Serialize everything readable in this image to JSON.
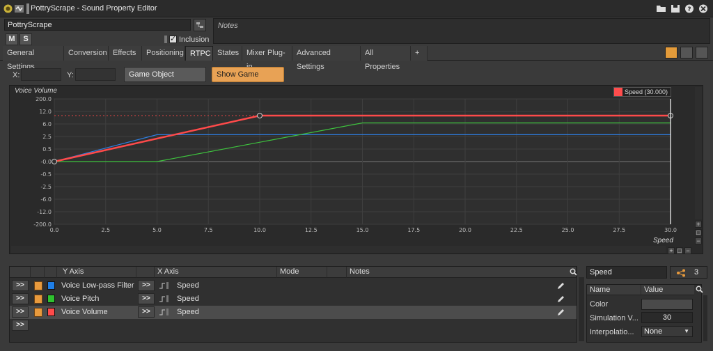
{
  "window": {
    "title": "PottryScrape - Sound Property Editor"
  },
  "object": {
    "name": "PottryScrape",
    "mute_label": "M",
    "solo_label": "S",
    "inclusion_label": "Inclusion",
    "notes_placeholder": "Notes"
  },
  "tabs": [
    "General Settings",
    "Conversion",
    "Effects",
    "Positioning",
    "RTPC",
    "States",
    "Mixer Plug-in",
    "Advanced Settings",
    "All Properties",
    "+"
  ],
  "active_tab": "RTPC",
  "toolbar": {
    "x_label": "X:",
    "y_label": "Y:",
    "explorer_label": "Game Object Explorer...",
    "show_objects_label": "Show Game Objects"
  },
  "graph": {
    "title": "Voice Volume",
    "x_axis_name": "Speed",
    "legend_text": "Speed (30.000)",
    "legend_color": "#ff4d4d"
  },
  "chart_data": {
    "type": "line",
    "xlabel": "Speed",
    "ylabel": "Voice Volume",
    "x_ticks": [
      "0.0",
      "2.5",
      "5.0",
      "7.5",
      "10.0",
      "12.5",
      "15.0",
      "17.5",
      "20.0",
      "22.5",
      "25.0",
      "27.5",
      "30.0"
    ],
    "y_ticks": [
      "200.0",
      "12.0",
      "6.0",
      "2.5",
      "0.5",
      "-0.0",
      "-0.5",
      "-2.5",
      "-6.0",
      "-12.0",
      "-200.0"
    ],
    "xlim": [
      0,
      30
    ],
    "cursor_x": 30.0,
    "series": [
      {
        "name": "Voice Volume",
        "color": "#ff4a4a",
        "points": [
          [
            0,
            0
          ],
          [
            10,
            10
          ],
          [
            30,
            10
          ]
        ]
      },
      {
        "name": "Voice Pitch",
        "color": "#3ec43e",
        "points": [
          [
            0,
            0
          ],
          [
            5,
            0
          ],
          [
            15,
            6.5
          ],
          [
            30,
            6.5
          ]
        ]
      },
      {
        "name": "Voice Low-pass Filter",
        "color": "#2e7de0",
        "points": [
          [
            0,
            0
          ],
          [
            5,
            3
          ],
          [
            30,
            3
          ]
        ]
      }
    ]
  },
  "rtpc_table": {
    "headers": {
      "y_axis": "Y Axis",
      "x_axis": "X Axis",
      "mode": "Mode",
      "notes": "Notes"
    },
    "add_row_label": ">>",
    "rows": [
      {
        "arrow": ">>",
        "color": "#1f7fe8",
        "y_axis": "Voice Low-pass Filter",
        "x_arrow": ">>",
        "x_axis": "Speed",
        "selected": false
      },
      {
        "arrow": ">>",
        "color": "#2fc22f",
        "y_axis": "Voice Pitch",
        "x_arrow": ">>",
        "x_axis": "Speed",
        "selected": false
      },
      {
        "arrow": ">>",
        "color": "#ff4a4a",
        "y_axis": "Voice Volume",
        "x_arrow": ">>",
        "x_axis": "Speed",
        "selected": true
      }
    ]
  },
  "properties": {
    "name": "Speed",
    "count": "3",
    "headers": {
      "name": "Name",
      "value": "Value"
    },
    "rows": [
      {
        "label": "Color",
        "value": ""
      },
      {
        "label": "Simulation V...",
        "value": "30"
      },
      {
        "label": "Interpolatio...",
        "value": "None"
      }
    ]
  }
}
